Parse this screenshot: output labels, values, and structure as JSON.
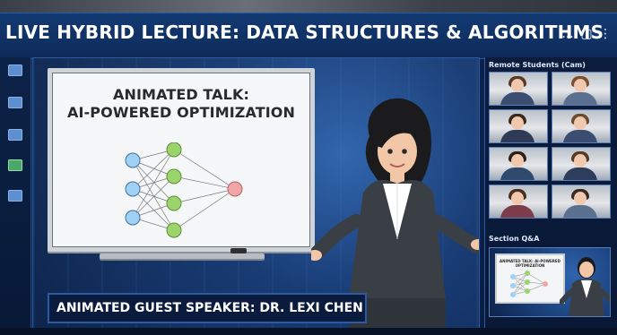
{
  "window": {
    "title": "LIVE HYBRID LECTURE: DATA STRUCTURES & ALGORITHMS",
    "controls": {
      "minimize": "...",
      "maximize": "▢",
      "more": "⋮"
    }
  },
  "left_rail": {
    "items": [
      {
        "label": "",
        "icon": "screen-share-icon"
      },
      {
        "label": "",
        "icon": "chat-icon"
      },
      {
        "label": "",
        "icon": "folder-icon"
      },
      {
        "label": "",
        "icon": "phone-icon"
      },
      {
        "label": "",
        "icon": "people-icon"
      }
    ]
  },
  "stage": {
    "whiteboard": {
      "heading_line1": "ANIMATED TALK:",
      "heading_line2": "AI-POWERED OPTIMIZATION"
    },
    "banner": "ANIMATED GUEST SPEAKER: DR. LEXI CHEN"
  },
  "right_panel": {
    "participants_heading": "Remote Students (Cam)",
    "participants": [
      {
        "name": ""
      },
      {
        "name": ""
      },
      {
        "name": ""
      },
      {
        "name": ""
      },
      {
        "name": ""
      },
      {
        "name": ""
      },
      {
        "name": ""
      },
      {
        "name": ""
      }
    ],
    "qa_heading": "Section Q&A",
    "qa_thumbnail_title": "ANIMATED TALK: AI-POWERED OPTIMIZATION",
    "qa_caption": ""
  },
  "colors": {
    "accent": "#2b5aa0",
    "node_input": "#9fd0f5",
    "node_hidden": "#9bd36c",
    "node_output": "#f0a6a6"
  }
}
